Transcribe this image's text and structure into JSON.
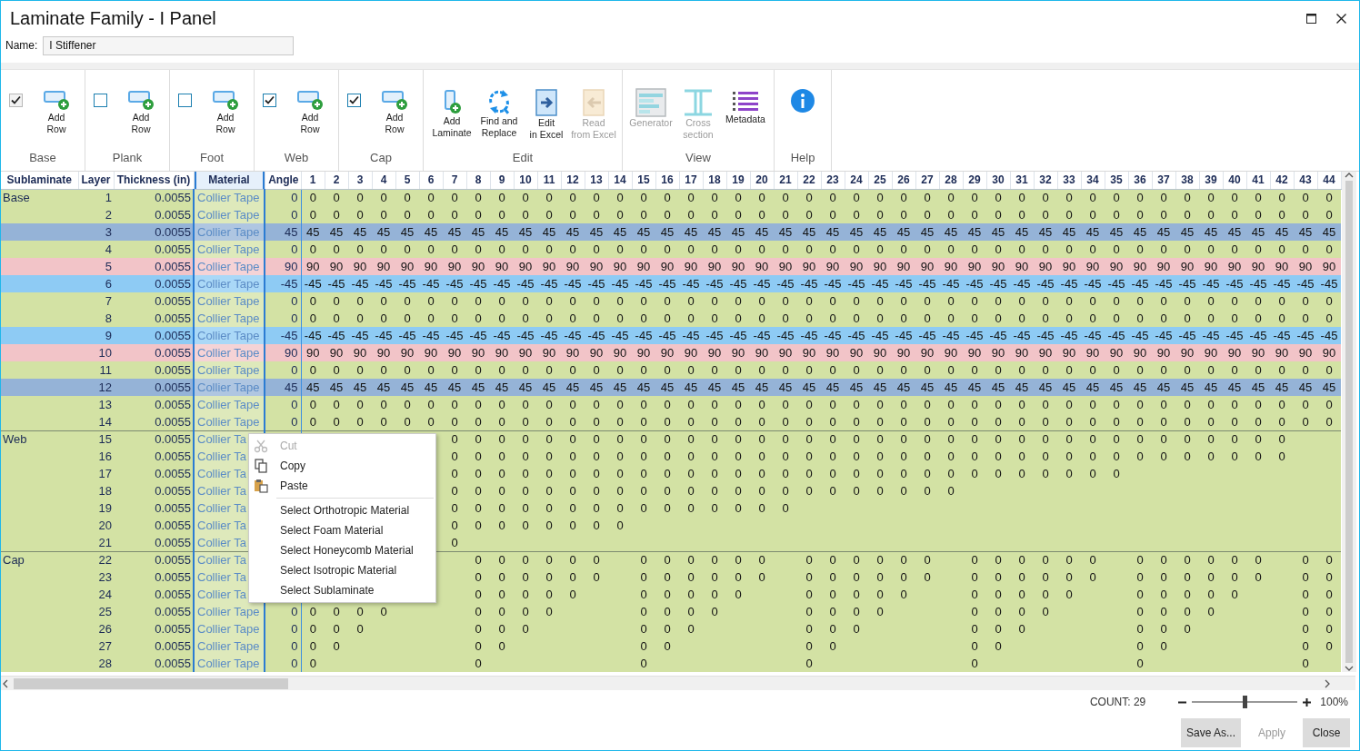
{
  "window": {
    "title": "Laminate Family - I Panel"
  },
  "name_field": {
    "label": "Name:",
    "value": "I Stiffener"
  },
  "ribbon": {
    "groups": [
      {
        "label": "Base",
        "items": [
          {
            "kind": "checkbox",
            "checked": true,
            "disabled": true
          },
          {
            "kind": "add_row",
            "lines": [
              "Add",
              "Row"
            ],
            "disabled": false
          }
        ]
      },
      {
        "label": "Plank",
        "items": [
          {
            "kind": "checkbox",
            "checked": false,
            "disabled": false
          },
          {
            "kind": "add_row",
            "lines": [
              "Add",
              "Row"
            ],
            "disabled": false
          }
        ]
      },
      {
        "label": "Foot",
        "items": [
          {
            "kind": "checkbox",
            "checked": false,
            "disabled": false
          },
          {
            "kind": "add_row",
            "lines": [
              "Add",
              "Row"
            ],
            "disabled": false
          }
        ]
      },
      {
        "label": "Web",
        "items": [
          {
            "kind": "checkbox",
            "checked": true,
            "disabled": false
          },
          {
            "kind": "add_row",
            "lines": [
              "Add",
              "Row"
            ],
            "disabled": false
          }
        ]
      },
      {
        "label": "Cap",
        "items": [
          {
            "kind": "checkbox",
            "checked": true,
            "disabled": false
          },
          {
            "kind": "add_row",
            "lines": [
              "Add",
              "Row"
            ],
            "disabled": false
          }
        ]
      },
      {
        "label": "Edit",
        "items": [
          {
            "kind": "add_laminate",
            "lines": [
              "Add",
              "Laminate"
            ],
            "disabled": false
          },
          {
            "kind": "find_replace",
            "lines": [
              "Find and",
              "Replace"
            ],
            "disabled": false
          },
          {
            "kind": "edit_excel",
            "lines": [
              "Edit",
              "in Excel"
            ],
            "disabled": false
          },
          {
            "kind": "read_excel",
            "lines": [
              "Read",
              "from Excel"
            ],
            "disabled": true
          }
        ]
      },
      {
        "label": "View",
        "items": [
          {
            "kind": "generator",
            "lines": [
              "Generator"
            ],
            "disabled": true
          },
          {
            "kind": "cross_section",
            "lines": [
              "Cross",
              "section"
            ],
            "disabled": true
          },
          {
            "kind": "metadata",
            "lines": [
              "Metadata"
            ],
            "disabled": false
          }
        ]
      },
      {
        "label": "Help",
        "items": [
          {
            "kind": "help"
          }
        ]
      }
    ]
  },
  "grid": {
    "columns": [
      {
        "label": "Sublaminate",
        "selected": false
      },
      {
        "label": "Layer",
        "selected": false
      },
      {
        "label": "Thickness (in)",
        "selected": false
      },
      {
        "label": "Material",
        "selected": true
      },
      {
        "label": "Angle",
        "selected": false
      }
    ],
    "ply_columns": [
      "1",
      "2",
      "3",
      "4",
      "5",
      "6",
      "7",
      "8",
      "9",
      "10",
      "11",
      "12",
      "13",
      "14",
      "15",
      "16",
      "17",
      "18",
      "19",
      "20",
      "21",
      "22",
      "23",
      "24",
      "25",
      "26",
      "27",
      "28",
      "29",
      "30",
      "31",
      "32",
      "33",
      "34",
      "35",
      "36",
      "37",
      "38",
      "39",
      "40",
      "41",
      "42",
      "43",
      "44"
    ],
    "rows": [
      {
        "sublaminate": "Base",
        "layer": "1",
        "thickness": "0.0055",
        "material": "Collier Tape",
        "angle": "0",
        "color": "#d3e2a4",
        "cells": [
          "0",
          "0",
          "0",
          "0",
          "0",
          "0",
          "0",
          "0",
          "0",
          "0",
          "0",
          "0",
          "0",
          "0",
          "0",
          "0",
          "0",
          "0",
          "0",
          "0",
          "0",
          "0",
          "0",
          "0",
          "0",
          "0",
          "0",
          "0",
          "0",
          "0",
          "0",
          "0",
          "0",
          "0",
          "0",
          "0",
          "0",
          "0",
          "0",
          "0",
          "0",
          "0",
          "0",
          "0"
        ]
      },
      {
        "layer": "2",
        "thickness": "0.0055",
        "material": "Collier Tape",
        "angle": "0",
        "color": "#d3e2a4",
        "cells": [
          "0",
          "0",
          "0",
          "0",
          "0",
          "0",
          "0",
          "0",
          "0",
          "0",
          "0",
          "0",
          "0",
          "0",
          "0",
          "0",
          "0",
          "0",
          "0",
          "0",
          "0",
          "0",
          "0",
          "0",
          "0",
          "0",
          "0",
          "0",
          "0",
          "0",
          "0",
          "0",
          "0",
          "0",
          "0",
          "0",
          "0",
          "0",
          "0",
          "0",
          "0",
          "0",
          "0",
          "0"
        ]
      },
      {
        "layer": "3",
        "thickness": "0.0055",
        "material": "Collier Tape",
        "angle": "45",
        "color": "#95b3d7",
        "cells": [
          "45",
          "45",
          "45",
          "45",
          "45",
          "45",
          "45",
          "45",
          "45",
          "45",
          "45",
          "45",
          "45",
          "45",
          "45",
          "45",
          "45",
          "45",
          "45",
          "45",
          "45",
          "45",
          "45",
          "45",
          "45",
          "45",
          "45",
          "45",
          "45",
          "45",
          "45",
          "45",
          "45",
          "45",
          "45",
          "45",
          "45",
          "45",
          "45",
          "45",
          "45",
          "45",
          "45",
          "45"
        ]
      },
      {
        "layer": "4",
        "thickness": "0.0055",
        "material": "Collier Tape",
        "angle": "0",
        "color": "#d3e2a4",
        "cells": [
          "0",
          "0",
          "0",
          "0",
          "0",
          "0",
          "0",
          "0",
          "0",
          "0",
          "0",
          "0",
          "0",
          "0",
          "0",
          "0",
          "0",
          "0",
          "0",
          "0",
          "0",
          "0",
          "0",
          "0",
          "0",
          "0",
          "0",
          "0",
          "0",
          "0",
          "0",
          "0",
          "0",
          "0",
          "0",
          "0",
          "0",
          "0",
          "0",
          "0",
          "0",
          "0",
          "0",
          "0"
        ]
      },
      {
        "layer": "5",
        "thickness": "0.0055",
        "material": "Collier Tape",
        "angle": "90",
        "color": "#f2c4c8",
        "cells": [
          "90",
          "90",
          "90",
          "90",
          "90",
          "90",
          "90",
          "90",
          "90",
          "90",
          "90",
          "90",
          "90",
          "90",
          "90",
          "90",
          "90",
          "90",
          "90",
          "90",
          "90",
          "90",
          "90",
          "90",
          "90",
          "90",
          "90",
          "90",
          "90",
          "90",
          "90",
          "90",
          "90",
          "90",
          "90",
          "90",
          "90",
          "90",
          "90",
          "90",
          "90",
          "90",
          "90",
          "90"
        ]
      },
      {
        "layer": "6",
        "thickness": "0.0055",
        "material": "Collier Tape",
        "angle": "-45",
        "color": "#8ecbf4",
        "cells": [
          "-45",
          "-45",
          "-45",
          "-45",
          "-45",
          "-45",
          "-45",
          "-45",
          "-45",
          "-45",
          "-45",
          "-45",
          "-45",
          "-45",
          "-45",
          "-45",
          "-45",
          "-45",
          "-45",
          "-45",
          "-45",
          "-45",
          "-45",
          "-45",
          "-45",
          "-45",
          "-45",
          "-45",
          "-45",
          "-45",
          "-45",
          "-45",
          "-45",
          "-45",
          "-45",
          "-45",
          "-45",
          "-45",
          "-45",
          "-45",
          "-45",
          "-45",
          "-45",
          "-45"
        ]
      },
      {
        "layer": "7",
        "thickness": "0.0055",
        "material": "Collier Tape",
        "angle": "0",
        "color": "#d3e2a4",
        "cells": [
          "0",
          "0",
          "0",
          "0",
          "0",
          "0",
          "0",
          "0",
          "0",
          "0",
          "0",
          "0",
          "0",
          "0",
          "0",
          "0",
          "0",
          "0",
          "0",
          "0",
          "0",
          "0",
          "0",
          "0",
          "0",
          "0",
          "0",
          "0",
          "0",
          "0",
          "0",
          "0",
          "0",
          "0",
          "0",
          "0",
          "0",
          "0",
          "0",
          "0",
          "0",
          "0",
          "0",
          "0"
        ]
      },
      {
        "layer": "8",
        "thickness": "0.0055",
        "material": "Collier Tape",
        "angle": "0",
        "color": "#d3e2a4",
        "cells": [
          "0",
          "0",
          "0",
          "0",
          "0",
          "0",
          "0",
          "0",
          "0",
          "0",
          "0",
          "0",
          "0",
          "0",
          "0",
          "0",
          "0",
          "0",
          "0",
          "0",
          "0",
          "0",
          "0",
          "0",
          "0",
          "0",
          "0",
          "0",
          "0",
          "0",
          "0",
          "0",
          "0",
          "0",
          "0",
          "0",
          "0",
          "0",
          "0",
          "0",
          "0",
          "0",
          "0",
          "0"
        ]
      },
      {
        "layer": "9",
        "thickness": "0.0055",
        "material": "Collier Tape",
        "angle": "-45",
        "color": "#8ecbf4",
        "cells": [
          "-45",
          "-45",
          "-45",
          "-45",
          "-45",
          "-45",
          "-45",
          "-45",
          "-45",
          "-45",
          "-45",
          "-45",
          "-45",
          "-45",
          "-45",
          "-45",
          "-45",
          "-45",
          "-45",
          "-45",
          "-45",
          "-45",
          "-45",
          "-45",
          "-45",
          "-45",
          "-45",
          "-45",
          "-45",
          "-45",
          "-45",
          "-45",
          "-45",
          "-45",
          "-45",
          "-45",
          "-45",
          "-45",
          "-45",
          "-45",
          "-45",
          "-45",
          "-45",
          "-45"
        ]
      },
      {
        "layer": "10",
        "thickness": "0.0055",
        "material": "Collier Tape",
        "angle": "90",
        "color": "#f2c4c8",
        "cells": [
          "90",
          "90",
          "90",
          "90",
          "90",
          "90",
          "90",
          "90",
          "90",
          "90",
          "90",
          "90",
          "90",
          "90",
          "90",
          "90",
          "90",
          "90",
          "90",
          "90",
          "90",
          "90",
          "90",
          "90",
          "90",
          "90",
          "90",
          "90",
          "90",
          "90",
          "90",
          "90",
          "90",
          "90",
          "90",
          "90",
          "90",
          "90",
          "90",
          "90",
          "90",
          "90",
          "90",
          "90"
        ]
      },
      {
        "layer": "11",
        "thickness": "0.0055",
        "material": "Collier Tape",
        "angle": "0",
        "color": "#d3e2a4",
        "cells": [
          "0",
          "0",
          "0",
          "0",
          "0",
          "0",
          "0",
          "0",
          "0",
          "0",
          "0",
          "0",
          "0",
          "0",
          "0",
          "0",
          "0",
          "0",
          "0",
          "0",
          "0",
          "0",
          "0",
          "0",
          "0",
          "0",
          "0",
          "0",
          "0",
          "0",
          "0",
          "0",
          "0",
          "0",
          "0",
          "0",
          "0",
          "0",
          "0",
          "0",
          "0",
          "0",
          "0",
          "0"
        ]
      },
      {
        "layer": "12",
        "thickness": "0.0055",
        "material": "Collier Tape",
        "angle": "45",
        "color": "#95b3d7",
        "cells": [
          "45",
          "45",
          "45",
          "45",
          "45",
          "45",
          "45",
          "45",
          "45",
          "45",
          "45",
          "45",
          "45",
          "45",
          "45",
          "45",
          "45",
          "45",
          "45",
          "45",
          "45",
          "45",
          "45",
          "45",
          "45",
          "45",
          "45",
          "45",
          "45",
          "45",
          "45",
          "45",
          "45",
          "45",
          "45",
          "45",
          "45",
          "45",
          "45",
          "45",
          "45",
          "45",
          "45",
          "45"
        ]
      },
      {
        "layer": "13",
        "thickness": "0.0055",
        "material": "Collier Tape",
        "angle": "0",
        "color": "#d3e2a4",
        "cells": [
          "0",
          "0",
          "0",
          "0",
          "0",
          "0",
          "0",
          "0",
          "0",
          "0",
          "0",
          "0",
          "0",
          "0",
          "0",
          "0",
          "0",
          "0",
          "0",
          "0",
          "0",
          "0",
          "0",
          "0",
          "0",
          "0",
          "0",
          "0",
          "0",
          "0",
          "0",
          "0",
          "0",
          "0",
          "0",
          "0",
          "0",
          "0",
          "0",
          "0",
          "0",
          "0",
          "0",
          "0"
        ]
      },
      {
        "layer": "14",
        "thickness": "0.0055",
        "material": "Collier Tape",
        "angle": "0",
        "color": "#d3e2a4",
        "cells": [
          "0",
          "0",
          "0",
          "0",
          "0",
          "0",
          "0",
          "0",
          "0",
          "0",
          "0",
          "0",
          "0",
          "0",
          "0",
          "0",
          "0",
          "0",
          "0",
          "0",
          "0",
          "0",
          "0",
          "0",
          "0",
          "0",
          "0",
          "0",
          "0",
          "0",
          "0",
          "0",
          "0",
          "0",
          "0",
          "0",
          "0",
          "0",
          "0",
          "0",
          "0",
          "0",
          "0",
          "0"
        ]
      },
      {
        "sublaminate": "Web",
        "layer": "15",
        "thickness": "0.0055",
        "material": "Collier Ta",
        "angle": null,
        "color": "#d3e2a4",
        "cells": [
          null,
          null,
          null,
          null,
          null,
          null,
          "0",
          "0",
          "0",
          "0",
          "0",
          "0",
          "0",
          "0",
          "0",
          "0",
          "0",
          "0",
          "0",
          "0",
          "0",
          "0",
          "0",
          "0",
          "0",
          "0",
          "0",
          "0",
          "0",
          "0",
          "0",
          "0",
          "0",
          "0",
          "0",
          "0",
          "0",
          "0",
          "0",
          "0",
          "0",
          "0",
          null,
          null
        ]
      },
      {
        "layer": "16",
        "thickness": "0.0055",
        "material": "Collier Ta",
        "angle": null,
        "color": "#d3e2a4",
        "cells": [
          null,
          null,
          null,
          null,
          null,
          null,
          "0",
          "0",
          "0",
          "0",
          "0",
          "0",
          "0",
          "0",
          "0",
          "0",
          "0",
          "0",
          "0",
          "0",
          "0",
          "0",
          "0",
          "0",
          "0",
          "0",
          "0",
          "0",
          "0",
          "0",
          "0",
          "0",
          "0",
          "0",
          "0",
          "0",
          "0",
          "0",
          "0",
          "0",
          "0",
          "0",
          null,
          null
        ]
      },
      {
        "layer": "17",
        "thickness": "0.0055",
        "material": "Collier Ta",
        "angle": null,
        "color": "#d3e2a4",
        "cells": [
          null,
          null,
          null,
          null,
          null,
          null,
          "0",
          "0",
          "0",
          "0",
          "0",
          "0",
          "0",
          "0",
          "0",
          "0",
          "0",
          "0",
          "0",
          "0",
          "0",
          "0",
          "0",
          "0",
          "0",
          "0",
          "0",
          "0",
          "0",
          "0",
          "0",
          "0",
          "0",
          "0",
          "0",
          null,
          null,
          null,
          null,
          null,
          null,
          null,
          null,
          null
        ]
      },
      {
        "layer": "18",
        "thickness": "0.0055",
        "material": "Collier Ta",
        "angle": null,
        "color": "#d3e2a4",
        "cells": [
          null,
          null,
          null,
          null,
          null,
          null,
          "0",
          "0",
          "0",
          "0",
          "0",
          "0",
          "0",
          "0",
          "0",
          "0",
          "0",
          "0",
          "0",
          "0",
          "0",
          "0",
          "0",
          "0",
          "0",
          "0",
          "0",
          "0",
          null,
          null,
          null,
          null,
          null,
          null,
          null,
          null,
          null,
          null,
          null,
          null,
          null,
          null,
          null,
          null
        ]
      },
      {
        "layer": "19",
        "thickness": "0.0055",
        "material": "Collier Ta",
        "angle": null,
        "color": "#d3e2a4",
        "cells": [
          null,
          null,
          null,
          null,
          null,
          null,
          "0",
          "0",
          "0",
          "0",
          "0",
          "0",
          "0",
          "0",
          "0",
          "0",
          "0",
          "0",
          "0",
          "0",
          "0",
          null,
          null,
          null,
          null,
          null,
          null,
          null,
          null,
          null,
          null,
          null,
          null,
          null,
          null,
          null,
          null,
          null,
          null,
          null,
          null,
          null,
          null,
          null
        ]
      },
      {
        "layer": "20",
        "thickness": "0.0055",
        "material": "Collier Ta",
        "angle": null,
        "color": "#d3e2a4",
        "cells": [
          null,
          null,
          null,
          null,
          null,
          null,
          "0",
          "0",
          "0",
          "0",
          "0",
          "0",
          "0",
          "0",
          null,
          null,
          null,
          null,
          null,
          null,
          null,
          null,
          null,
          null,
          null,
          null,
          null,
          null,
          null,
          null,
          null,
          null,
          null,
          null,
          null,
          null,
          null,
          null,
          null,
          null,
          null,
          null,
          null,
          null
        ]
      },
      {
        "layer": "21",
        "thickness": "0.0055",
        "material": "Collier Ta",
        "angle": null,
        "color": "#d3e2a4",
        "cells": [
          null,
          null,
          null,
          null,
          null,
          null,
          "0",
          null,
          null,
          null,
          null,
          null,
          null,
          null,
          null,
          null,
          null,
          null,
          null,
          null,
          null,
          null,
          null,
          null,
          null,
          null,
          null,
          null,
          null,
          null,
          null,
          null,
          null,
          null,
          null,
          null,
          null,
          null,
          null,
          null,
          null,
          null,
          null,
          null
        ]
      },
      {
        "sublaminate": "Cap",
        "layer": "22",
        "thickness": "0.0055",
        "material": "Collier Ta",
        "angle": null,
        "color": "#d3e2a4",
        "cells": [
          null,
          null,
          null,
          null,
          null,
          null,
          null,
          "0",
          "0",
          "0",
          "0",
          "0",
          "0",
          null,
          "0",
          "0",
          "0",
          "0",
          "0",
          "0",
          null,
          "0",
          "0",
          "0",
          "0",
          "0",
          "0",
          null,
          "0",
          "0",
          "0",
          "0",
          "0",
          "0",
          null,
          "0",
          "0",
          "0",
          "0",
          "0",
          "0",
          null,
          "0",
          "0"
        ]
      },
      {
        "layer": "23",
        "thickness": "0.0055",
        "material": "Collier Ta",
        "angle": null,
        "color": "#d3e2a4",
        "cells": [
          null,
          null,
          null,
          null,
          null,
          null,
          null,
          "0",
          "0",
          "0",
          "0",
          "0",
          "0",
          null,
          "0",
          "0",
          "0",
          "0",
          "0",
          "0",
          null,
          "0",
          "0",
          "0",
          "0",
          "0",
          "0",
          null,
          "0",
          "0",
          "0",
          "0",
          "0",
          "0",
          null,
          "0",
          "0",
          "0",
          "0",
          "0",
          "0",
          null,
          "0",
          "0"
        ]
      },
      {
        "layer": "24",
        "thickness": "0.0055",
        "material": "Collier Ta",
        "angle": null,
        "color": "#d3e2a4",
        "cells": [
          null,
          null,
          null,
          null,
          null,
          null,
          null,
          "0",
          "0",
          "0",
          "0",
          "0",
          null,
          null,
          "0",
          "0",
          "0",
          "0",
          "0",
          null,
          null,
          "0",
          "0",
          "0",
          "0",
          "0",
          null,
          null,
          "0",
          "0",
          "0",
          "0",
          "0",
          null,
          null,
          "0",
          "0",
          "0",
          "0",
          "0",
          null,
          null,
          "0",
          "0"
        ]
      },
      {
        "layer": "25",
        "thickness": "0.0055",
        "material": "Collier Tape",
        "angle": "0",
        "color": "#d3e2a4",
        "cells": [
          "0",
          "0",
          "0",
          "0",
          null,
          null,
          null,
          "0",
          "0",
          "0",
          "0",
          null,
          null,
          null,
          "0",
          "0",
          "0",
          "0",
          null,
          null,
          null,
          "0",
          "0",
          "0",
          "0",
          null,
          null,
          null,
          "0",
          "0",
          "0",
          "0",
          null,
          null,
          null,
          "0",
          "0",
          "0",
          "0",
          null,
          null,
          null,
          "0",
          "0"
        ]
      },
      {
        "layer": "26",
        "thickness": "0.0055",
        "material": "Collier Tape",
        "angle": "0",
        "color": "#d3e2a4",
        "cells": [
          "0",
          "0",
          "0",
          null,
          null,
          null,
          null,
          "0",
          "0",
          "0",
          null,
          null,
          null,
          null,
          "0",
          "0",
          "0",
          null,
          null,
          null,
          null,
          "0",
          "0",
          "0",
          null,
          null,
          null,
          null,
          "0",
          "0",
          "0",
          null,
          null,
          null,
          null,
          "0",
          "0",
          "0",
          null,
          null,
          null,
          null,
          "0",
          "0"
        ]
      },
      {
        "layer": "27",
        "thickness": "0.0055",
        "material": "Collier Tape",
        "angle": "0",
        "color": "#d3e2a4",
        "cells": [
          "0",
          "0",
          null,
          null,
          null,
          null,
          null,
          "0",
          "0",
          null,
          null,
          null,
          null,
          null,
          "0",
          "0",
          null,
          null,
          null,
          null,
          null,
          "0",
          "0",
          null,
          null,
          null,
          null,
          null,
          "0",
          "0",
          null,
          null,
          null,
          null,
          null,
          "0",
          "0",
          null,
          null,
          null,
          null,
          null,
          "0",
          "0"
        ]
      },
      {
        "layer": "28",
        "thickness": "0.0055",
        "material": "Collier Tape",
        "angle": "0",
        "color": "#d3e2a4",
        "cells": [
          "0",
          null,
          null,
          null,
          null,
          null,
          null,
          "0",
          null,
          null,
          null,
          null,
          null,
          null,
          "0",
          null,
          null,
          null,
          null,
          null,
          null,
          "0",
          null,
          null,
          null,
          null,
          null,
          null,
          "0",
          null,
          null,
          null,
          null,
          null,
          null,
          "0",
          null,
          null,
          null,
          null,
          null,
          null,
          "0",
          null
        ]
      }
    ]
  },
  "context_menu": {
    "groups": [
      [
        {
          "kind": "cut",
          "label": "Cut",
          "disabled": true
        },
        {
          "kind": "copy",
          "label": "Copy",
          "disabled": false
        },
        {
          "kind": "paste",
          "label": "Paste",
          "disabled": false
        }
      ],
      [
        {
          "kind": "plain",
          "label": "Select Orthotropic Material",
          "disabled": false
        },
        {
          "kind": "plain",
          "label": "Select Foam Material",
          "disabled": false
        },
        {
          "kind": "plain",
          "label": "Select Honeycomb Material",
          "disabled": false
        },
        {
          "kind": "plain",
          "label": "Select Isotropic Material",
          "disabled": false
        },
        {
          "kind": "plain",
          "label": "Select Sublaminate",
          "disabled": false
        }
      ]
    ]
  },
  "status_bar": {
    "count": "COUNT: 29",
    "zoom": {
      "level": 0.5,
      "reading": "100%"
    }
  },
  "buttons": [
    {
      "label": "Save As...",
      "disabled": false
    },
    {
      "label": "Apply",
      "disabled": true
    },
    {
      "label": "Close",
      "disabled": false
    }
  ]
}
